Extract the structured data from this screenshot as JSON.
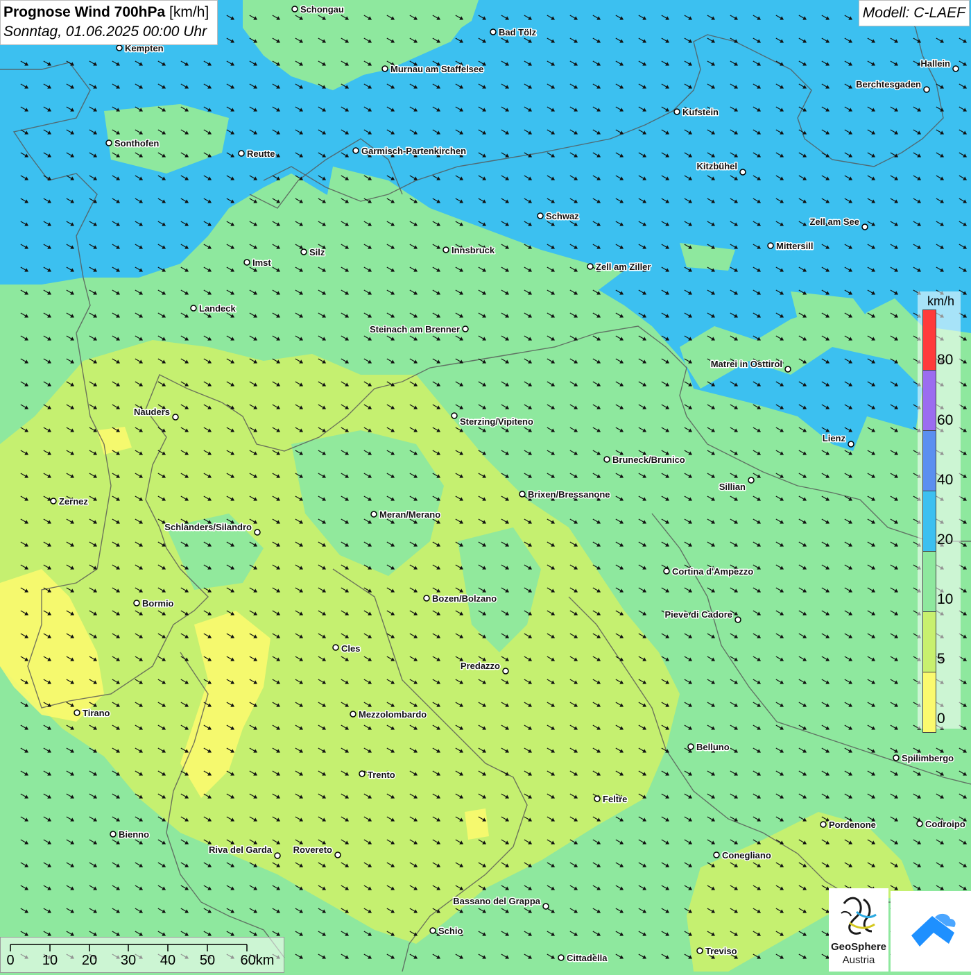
{
  "title": {
    "bold": "Prognose Wind 700hPa",
    "unit": "[km/h]",
    "subtitle": "Sonntag, 01.06.2025 00:00 Uhr"
  },
  "model": "Modell: C-LAEF",
  "legend": {
    "unit": "km/h",
    "classes": [
      {
        "label": "80",
        "color": "#ff3b3b"
      },
      {
        "label": "60",
        "color": "#9b6cf0"
      },
      {
        "label": "40",
        "color": "#5b8ff0"
      },
      {
        "label": "20",
        "color": "#3cc0f0"
      },
      {
        "label": "10",
        "color": "#8ee89e"
      },
      {
        "label": "5",
        "color": "#c8f06e"
      },
      {
        "label": "0",
        "color": "#fafa6e"
      }
    ]
  },
  "scalebar": {
    "labels": [
      "0",
      "10",
      "20",
      "30",
      "40",
      "50",
      "60km"
    ]
  },
  "logo": {
    "name": "GeoSphere",
    "sub": "Austria"
  },
  "wind_direction": "north-west wind (arrows pointing south-east)",
  "cities": [
    {
      "name": "Schongau"
    },
    {
      "name": "Kempten"
    },
    {
      "name": "Bad Tölz"
    },
    {
      "name": "Murnau am Staffelsee"
    },
    {
      "name": "Hallein"
    },
    {
      "name": "Berchtesgaden"
    },
    {
      "name": "Kufstein"
    },
    {
      "name": "Sonthofen"
    },
    {
      "name": "Reutte"
    },
    {
      "name": "Garmisch-Partenkirchen"
    },
    {
      "name": "Kitzbühel"
    },
    {
      "name": "Schwaz"
    },
    {
      "name": "Zell am See"
    },
    {
      "name": "Mittersill"
    },
    {
      "name": "Silz"
    },
    {
      "name": "Innsbruck"
    },
    {
      "name": "Imst"
    },
    {
      "name": "Zell am Ziller"
    },
    {
      "name": "Landeck"
    },
    {
      "name": "Steinach am Brenner"
    },
    {
      "name": "Matrei in Osttirol"
    },
    {
      "name": "Nauders"
    },
    {
      "name": "Sterzing/Vipiteno"
    },
    {
      "name": "Lienz"
    },
    {
      "name": "Bruneck/Brunico"
    },
    {
      "name": "Sillian"
    },
    {
      "name": "Brixen/Bressanone"
    },
    {
      "name": "Zernez"
    },
    {
      "name": "Meran/Merano"
    },
    {
      "name": "Schlanders/Silandro"
    },
    {
      "name": "Cortina d'Ampezzo"
    },
    {
      "name": "Bozen/Bolzano"
    },
    {
      "name": "Bormio"
    },
    {
      "name": "Pieve di Cadore"
    },
    {
      "name": "Cles"
    },
    {
      "name": "Predazzo"
    },
    {
      "name": "Tirano"
    },
    {
      "name": "Mezzolombardo"
    },
    {
      "name": "Belluno"
    },
    {
      "name": "Spilimbergo"
    },
    {
      "name": "Trento"
    },
    {
      "name": "Feltre"
    },
    {
      "name": "Pordenone"
    },
    {
      "name": "Codroipo"
    },
    {
      "name": "Bienno"
    },
    {
      "name": "Riva del Garda"
    },
    {
      "name": "Rovereto"
    },
    {
      "name": "Conegliano"
    },
    {
      "name": "Bassano del Grappa"
    },
    {
      "name": "Schio"
    },
    {
      "name": "Treviso"
    },
    {
      "name": "Cittadella"
    }
  ]
}
